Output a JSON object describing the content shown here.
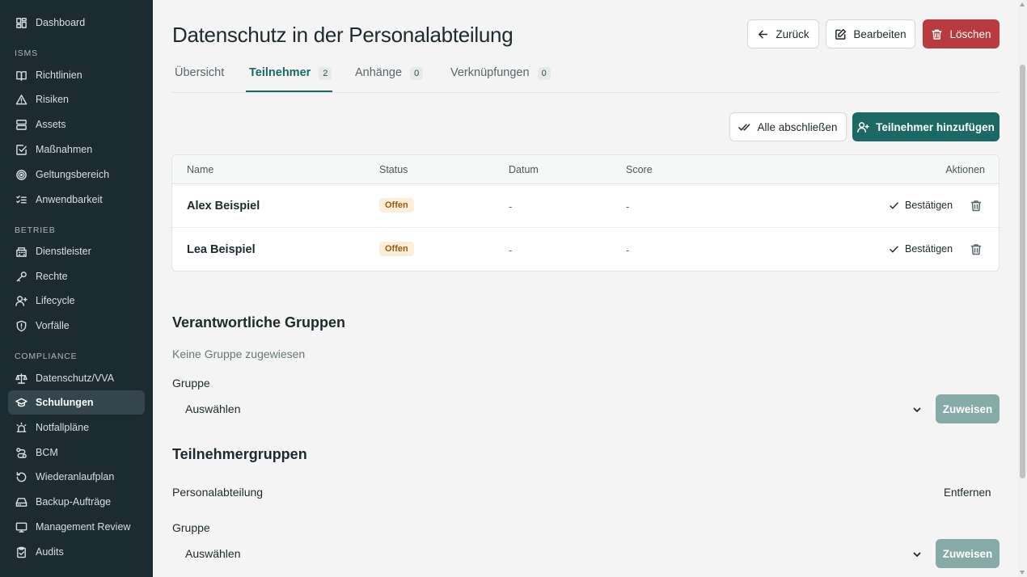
{
  "sidebar": {
    "top": [
      {
        "label": "Dashboard",
        "icon": "dashboard-icon"
      }
    ],
    "sections": [
      {
        "title": "ISMS",
        "items": [
          {
            "label": "Richtlinien",
            "icon": "book-icon"
          },
          {
            "label": "Risiken",
            "icon": "warning-triangle-icon"
          },
          {
            "label": "Assets",
            "icon": "server-icon"
          },
          {
            "label": "Maßnahmen",
            "icon": "checkbox-icon"
          },
          {
            "label": "Geltungsbereich",
            "icon": "target-icon"
          },
          {
            "label": "Anwendbarkeit",
            "icon": "list-check-icon"
          }
        ]
      },
      {
        "title": "BETRIEB",
        "items": [
          {
            "label": "Dienstleister",
            "icon": "building-icon"
          },
          {
            "label": "Rechte",
            "icon": "key-icon"
          },
          {
            "label": "Lifecycle",
            "icon": "user-plus-icon"
          },
          {
            "label": "Vorfälle",
            "icon": "shield-alert-icon"
          }
        ]
      },
      {
        "title": "COMPLIANCE",
        "items": [
          {
            "label": "Datenschutz/VVA",
            "icon": "scale-icon"
          },
          {
            "label": "Schulungen",
            "icon": "graduation-cap-icon",
            "active": true
          },
          {
            "label": "Notfallpläne",
            "icon": "siren-icon"
          },
          {
            "label": "BCM",
            "icon": "route-icon"
          },
          {
            "label": "Wiederanlaufplan",
            "icon": "rotate-icon"
          },
          {
            "label": "Backup-Aufträge",
            "icon": "hard-drive-icon"
          },
          {
            "label": "Management Review",
            "icon": "monitor-icon"
          },
          {
            "label": "Audits",
            "icon": "clipboard-icon"
          }
        ]
      }
    ]
  },
  "header": {
    "title": "Datenschutz in der Personalabteilung",
    "back_label": "Zurück",
    "edit_label": "Bearbeiten",
    "delete_label": "Löschen"
  },
  "tabs": [
    {
      "label": "Übersicht",
      "count": null
    },
    {
      "label": "Teilnehmer",
      "count": "2",
      "active": true
    },
    {
      "label": "Anhänge",
      "count": "0"
    },
    {
      "label": "Verknüpfungen",
      "count": "0"
    }
  ],
  "toolbar": {
    "complete_all_label": "Alle abschließen",
    "add_participant_label": "Teilnehmer hinzufügen"
  },
  "participants_table": {
    "columns": [
      "Name",
      "Status",
      "Datum",
      "Score",
      "Aktionen"
    ],
    "rows": [
      {
        "name": "Alex Beispiel",
        "status": "Offen",
        "date": "-",
        "score": "-",
        "action": "Bestätigen"
      },
      {
        "name": "Lea Beispiel",
        "status": "Offen",
        "date": "-",
        "score": "-",
        "action": "Bestätigen"
      }
    ]
  },
  "responsible_groups": {
    "title": "Verantwortliche Gruppen",
    "empty_text": "Keine Gruppe zugewiesen",
    "group_label": "Gruppe",
    "select_value": "Auswählen",
    "assign_label": "Zuweisen"
  },
  "participant_groups": {
    "title": "Teilnehmergruppen",
    "items": [
      {
        "name": "Personalabteilung",
        "remove_label": "Entfernen"
      }
    ],
    "group_label": "Gruppe",
    "select_value": "Auswählen",
    "assign_label": "Zuweisen"
  },
  "colors": {
    "sidebar_bg": "#1c2b31",
    "accent": "#1b6864",
    "danger": "#b93a3f",
    "badge_bg": "#fbefd9",
    "badge_text": "#9a5a12"
  }
}
